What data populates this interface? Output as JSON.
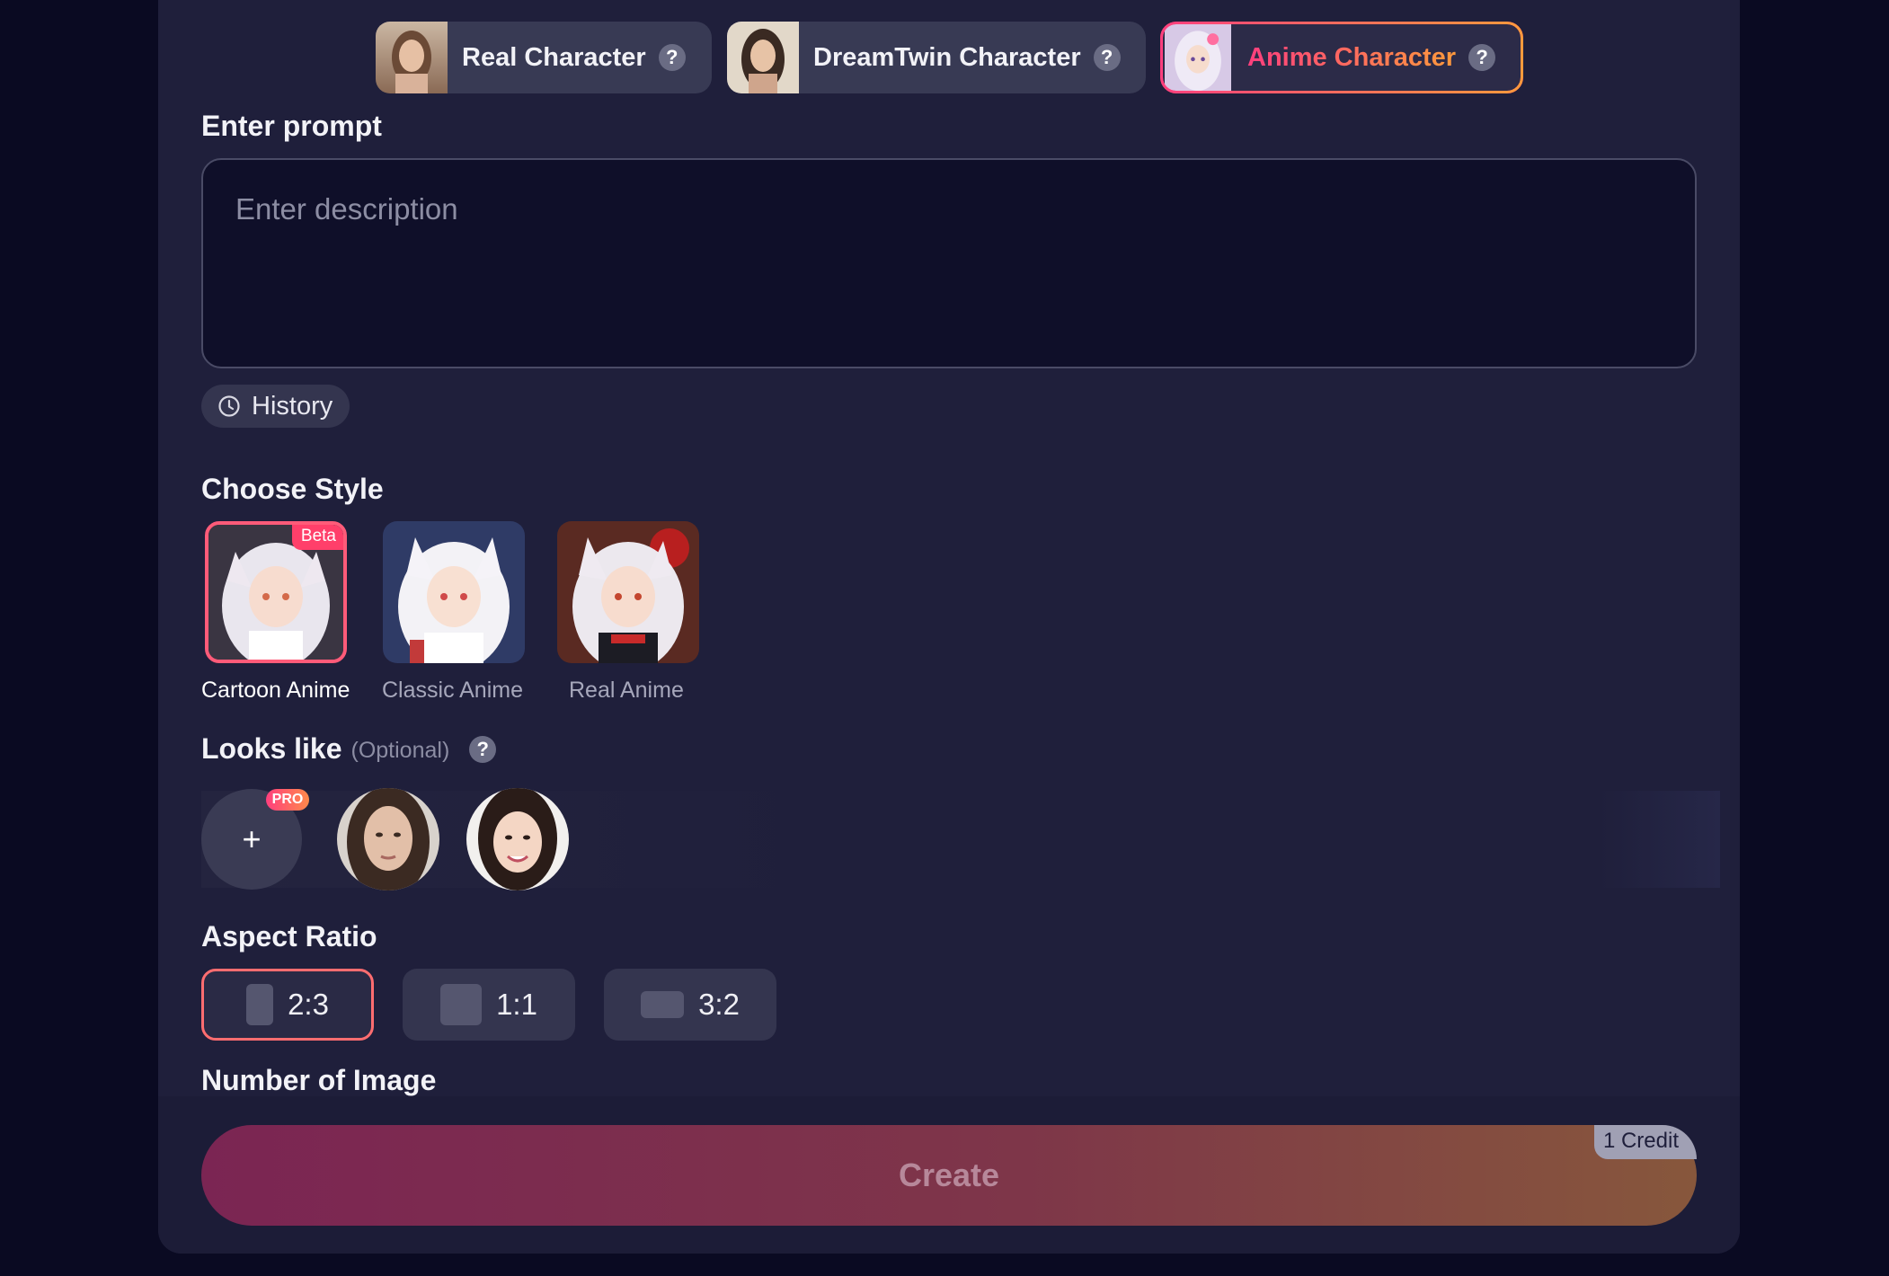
{
  "character_tabs": [
    {
      "label": "Real Character",
      "help": "?"
    },
    {
      "label": "DreamTwin Character",
      "help": "?"
    },
    {
      "label": "Anime Character",
      "help": "?",
      "active": true
    }
  ],
  "prompt": {
    "title": "Enter prompt",
    "placeholder": "Enter description"
  },
  "history": {
    "label": "History"
  },
  "style": {
    "title": "Choose Style",
    "options": [
      {
        "label": "Cartoon Anime",
        "badge": "Beta",
        "selected": true
      },
      {
        "label": "Classic Anime"
      },
      {
        "label": "Real Anime"
      }
    ]
  },
  "looks_like": {
    "title": "Looks like",
    "optional": "(Optional)",
    "help": "?",
    "add_symbol": "+",
    "pro_badge": "PRO"
  },
  "aspect_ratio": {
    "title": "Aspect Ratio",
    "options": [
      {
        "label": "2:3",
        "selected": true
      },
      {
        "label": "1:1"
      },
      {
        "label": "3:2"
      }
    ]
  },
  "number_of_image": {
    "title": "Number of Image"
  },
  "create": {
    "label": "Create",
    "credit": "1 Credit"
  },
  "colors": {
    "accent_start": "#ff3f7e",
    "accent_end": "#ff9a3c",
    "panel": "#1f1f3b",
    "page": "#0a0a22"
  }
}
